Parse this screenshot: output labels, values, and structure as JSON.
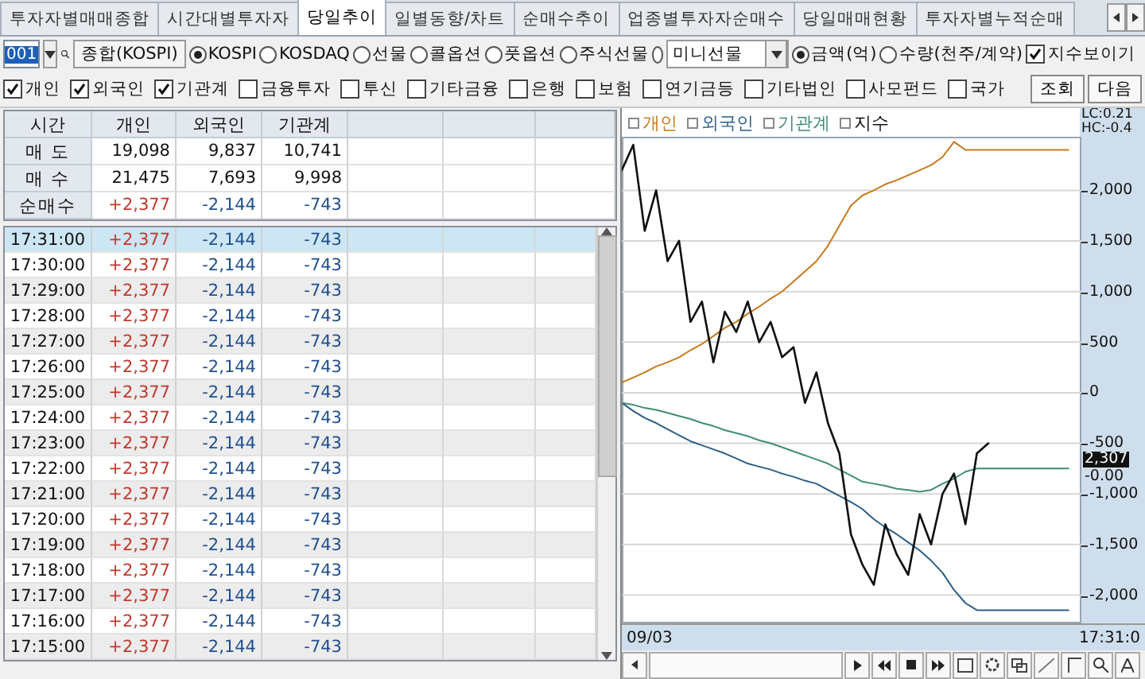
{
  "tabs": [
    {
      "label": "투자자별매매종합",
      "selected": false
    },
    {
      "label": "시간대별투자자",
      "selected": false
    },
    {
      "label": "당일추이",
      "selected": true
    },
    {
      "label": "일별동향/차트",
      "selected": false
    },
    {
      "label": "순매수추이",
      "selected": false
    },
    {
      "label": "업종별투자자순매수",
      "selected": false
    },
    {
      "label": "당일매매현황",
      "selected": false
    },
    {
      "label": "투자자별누적순매",
      "selected": false
    }
  ],
  "toolbar": {
    "code": "001",
    "name": "종합(KOSPI)",
    "markets": [
      {
        "label": "KOSPI",
        "selected": true
      },
      {
        "label": "KOSDAQ",
        "selected": false
      },
      {
        "label": "선물",
        "selected": false
      },
      {
        "label": "콜옵션",
        "selected": false
      },
      {
        "label": "풋옵션",
        "selected": false
      },
      {
        "label": "주식선물",
        "selected": false
      }
    ],
    "market_select": {
      "selected": false,
      "value": "미니선물"
    },
    "units": [
      {
        "label": "금액(억)",
        "selected": true
      },
      {
        "label": "수량(천주/계약)",
        "selected": false
      }
    ],
    "show_index": {
      "label": "지수보이기",
      "checked": true
    }
  },
  "investors": [
    {
      "label": "개인",
      "checked": true
    },
    {
      "label": "외국인",
      "checked": true
    },
    {
      "label": "기관계",
      "checked": true
    },
    {
      "label": "금융투자",
      "checked": false
    },
    {
      "label": "투신",
      "checked": false
    },
    {
      "label": "기타금융",
      "checked": false
    },
    {
      "label": "은행",
      "checked": false
    },
    {
      "label": "보험",
      "checked": false
    },
    {
      "label": "연기금등",
      "checked": false
    },
    {
      "label": "기타법인",
      "checked": false
    },
    {
      "label": "사모펀드",
      "checked": false
    },
    {
      "label": "국가",
      "checked": false
    }
  ],
  "buttons": [
    "조회",
    "다음"
  ],
  "summary": {
    "columns": [
      "시간",
      "개인",
      "외국인",
      "기관계"
    ],
    "rows": [
      {
        "label": "매 도",
        "kind": "plain",
        "values": [
          "19,098",
          "9,837",
          "10,741"
        ]
      },
      {
        "label": "매 수",
        "kind": "plain",
        "values": [
          "21,475",
          "7,693",
          "9,998"
        ]
      },
      {
        "label": "순매수",
        "kind": "net",
        "values": [
          "+2,377",
          "-2,144",
          "-743"
        ]
      }
    ]
  },
  "timeline": [
    {
      "time": "17:31:00",
      "selected": true,
      "values": [
        "+2,377",
        "-2,144",
        "-743"
      ]
    },
    {
      "time": "17:30:00",
      "selected": false,
      "values": [
        "+2,377",
        "-2,144",
        "-743"
      ]
    },
    {
      "time": "17:29:00",
      "selected": false,
      "values": [
        "+2,377",
        "-2,144",
        "-743"
      ]
    },
    {
      "time": "17:28:00",
      "selected": false,
      "values": [
        "+2,377",
        "-2,144",
        "-743"
      ]
    },
    {
      "time": "17:27:00",
      "selected": false,
      "values": [
        "+2,377",
        "-2,144",
        "-743"
      ]
    },
    {
      "time": "17:26:00",
      "selected": false,
      "values": [
        "+2,377",
        "-2,144",
        "-743"
      ]
    },
    {
      "time": "17:25:00",
      "selected": false,
      "values": [
        "+2,377",
        "-2,144",
        "-743"
      ]
    },
    {
      "time": "17:24:00",
      "selected": false,
      "values": [
        "+2,377",
        "-2,144",
        "-743"
      ]
    },
    {
      "time": "17:23:00",
      "selected": false,
      "values": [
        "+2,377",
        "-2,144",
        "-743"
      ]
    },
    {
      "time": "17:22:00",
      "selected": false,
      "values": [
        "+2,377",
        "-2,144",
        "-743"
      ]
    },
    {
      "time": "17:21:00",
      "selected": false,
      "values": [
        "+2,377",
        "-2,144",
        "-743"
      ]
    },
    {
      "time": "17:20:00",
      "selected": false,
      "values": [
        "+2,377",
        "-2,144",
        "-743"
      ]
    },
    {
      "time": "17:19:00",
      "selected": false,
      "values": [
        "+2,377",
        "-2,144",
        "-743"
      ]
    },
    {
      "time": "17:18:00",
      "selected": false,
      "values": [
        "+2,377",
        "-2,144",
        "-743"
      ]
    },
    {
      "time": "17:17:00",
      "selected": false,
      "values": [
        "+2,377",
        "-2,144",
        "-743"
      ]
    },
    {
      "time": "17:16:00",
      "selected": false,
      "values": [
        "+2,377",
        "-2,144",
        "-743"
      ]
    },
    {
      "time": "17:15:00",
      "selected": false,
      "values": [
        "+2,377",
        "-2,144",
        "-743"
      ]
    }
  ],
  "chart": {
    "lc": "LC:0.21",
    "hc": "HC:-0.4",
    "price_tag": "2,307",
    "zero_tag": "-0.00",
    "date": "09/03",
    "time": "17:31:0",
    "chart_data": {
      "type": "line",
      "grid": true,
      "ylim": [
        -2280,
        2530
      ],
      "yticks": [
        {
          "value": 2000,
          "label": "2,000"
        },
        {
          "value": 1500,
          "label": "1,500"
        },
        {
          "value": 1000,
          "label": "1,000"
        },
        {
          "value": 500,
          "label": "500"
        },
        {
          "value": 0,
          "label": "0"
        },
        {
          "value": -500,
          "label": "-500"
        },
        {
          "value": -1000,
          "label": "-1,000"
        },
        {
          "value": -1500,
          "label": "-1,500"
        },
        {
          "value": -2000,
          "label": "-2,000"
        }
      ],
      "series": [
        {
          "name": "개인",
          "color": "#c77a1c",
          "values": [
            100,
            150,
            200,
            260,
            300,
            350,
            420,
            480,
            560,
            640,
            700,
            780,
            850,
            930,
            1000,
            1100,
            1200,
            1300,
            1450,
            1650,
            1850,
            1950,
            2000,
            2060,
            2100,
            2150,
            2200,
            2250,
            2330,
            2480,
            2400,
            2400,
            2400,
            2400,
            2400,
            2400,
            2400,
            2400,
            2400,
            2400
          ]
        },
        {
          "name": "외국인",
          "color": "#2d5f86",
          "values": [
            -100,
            -180,
            -250,
            -300,
            -360,
            -420,
            -480,
            -520,
            -560,
            -600,
            -650,
            -700,
            -730,
            -760,
            -800,
            -830,
            -870,
            -900,
            -960,
            -1020,
            -1080,
            -1150,
            -1250,
            -1330,
            -1400,
            -1480,
            -1560,
            -1660,
            -1780,
            -1950,
            -2080,
            -2150,
            -2150,
            -2150,
            -2150,
            -2150,
            -2150,
            -2150,
            -2150,
            -2150
          ]
        },
        {
          "name": "기관계",
          "color": "#3f8f70",
          "values": [
            -100,
            -120,
            -150,
            -170,
            -200,
            -230,
            -260,
            -300,
            -330,
            -370,
            -400,
            -430,
            -470,
            -500,
            -540,
            -580,
            -620,
            -660,
            -700,
            -760,
            -820,
            -880,
            -900,
            -920,
            -950,
            -960,
            -980,
            -960,
            -900,
            -850,
            -780,
            -750,
            -750,
            -750,
            -750,
            -750,
            -750,
            -750,
            -750,
            -750
          ]
        },
        {
          "name": "지수",
          "color": "#111111",
          "values": [
            2200,
            2450,
            1600,
            2000,
            1300,
            1500,
            700,
            900,
            300,
            800,
            600,
            900,
            500,
            700,
            350,
            450,
            -100,
            200,
            -300,
            -600,
            -1400,
            -1700,
            -1900,
            -1300,
            -1600,
            -1800,
            -1200,
            -1500,
            -1000,
            -800,
            -1300,
            -600,
            -500,
            null,
            null,
            null,
            null,
            null,
            null,
            null
          ]
        }
      ]
    }
  }
}
